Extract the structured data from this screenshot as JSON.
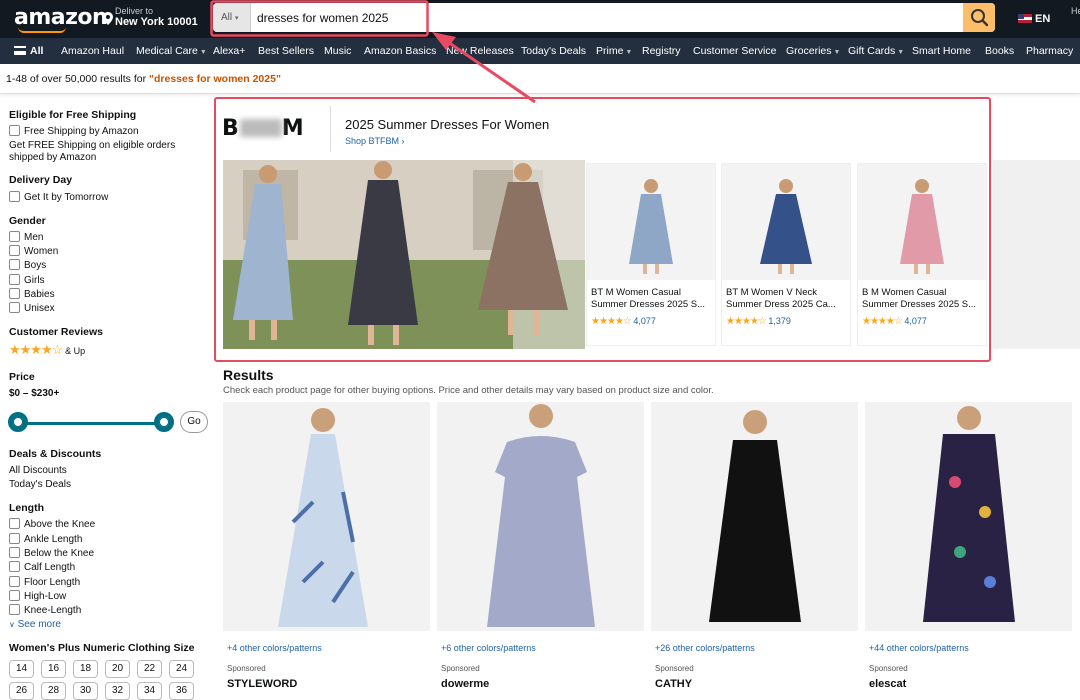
{
  "header": {
    "logo_text": "amazon",
    "deliver_line1": "Deliver to",
    "deliver_line2": "New York 10001",
    "search_category": "All",
    "search_query": "dresses for women 2025",
    "language": "EN",
    "account_partial": "He"
  },
  "nav": {
    "all_label": "All",
    "items": [
      "Amazon Haul",
      "Medical Care",
      "Alexa+",
      "Best Sellers",
      "Music",
      "Amazon Basics",
      "New Releases",
      "Today's Deals",
      "Prime",
      "Registry",
      "Customer Service",
      "Groceries",
      "Gift Cards",
      "Smart Home",
      "Books",
      "Pharmacy"
    ]
  },
  "results_bar": {
    "prefix": "1-48 of over 50,000 results for ",
    "query": "\"dresses for women 2025\""
  },
  "sidebar": {
    "shipping_heading": "Eligible for Free Shipping",
    "shipping_option": "Free Shipping by Amazon",
    "shipping_note_1": "Get FREE Shipping on eligible orders",
    "shipping_note_2": "shipped by Amazon",
    "delivery_heading": "Delivery Day",
    "delivery_option": "Get It by Tomorrow",
    "gender_heading": "Gender",
    "gender_options": [
      "Men",
      "Women",
      "Boys",
      "Girls",
      "Babies",
      "Unisex"
    ],
    "reviews_heading": "Customer Reviews",
    "reviews_suffix": "& Up",
    "price_heading": "Price",
    "price_range": "$0 – $230+",
    "price_go": "Go",
    "deals_heading": "Deals & Discounts",
    "deals_options": [
      "All Discounts",
      "Today's Deals"
    ],
    "length_heading": "Length",
    "length_options": [
      "Above the Knee",
      "Ankle Length",
      "Below the Knee",
      "Calf Length",
      "Floor Length",
      "High-Low",
      "Knee-Length"
    ],
    "see_more": "See more",
    "size_heading": "Women's Plus Numeric Clothing Size",
    "sizes": [
      "14",
      "16",
      "18",
      "20",
      "22",
      "24",
      "26",
      "28",
      "30",
      "32",
      "34",
      "36"
    ]
  },
  "banner": {
    "brand_left": "B",
    "brand_right": "M",
    "title": "2025 Summer Dresses For Women",
    "shop_link": "Shop BTFBM",
    "products": [
      {
        "title": "BT M Women Casual Summer Dresses 2025 S...",
        "rating_count": "4,077",
        "stars": 4.5
      },
      {
        "title": "BT M Women V Neck Summer Dress 2025 Ca...",
        "rating_count": "1,379",
        "stars": 4.5
      },
      {
        "title": "B M Women Casual Summer Dresses 2025 S...",
        "rating_count": "4,077",
        "stars": 4.5
      }
    ]
  },
  "results": {
    "title": "Results",
    "subtitle": "Check each product page for other buying options. Price and other details may vary based on product size and color.",
    "products": [
      {
        "colors": "+4 other colors/patterns",
        "sponsored": "Sponsored",
        "brand": "STYLEWORD"
      },
      {
        "colors": "+6 other colors/patterns",
        "sponsored": "Sponsored",
        "brand": "dowerme"
      },
      {
        "colors": "+26 other colors/patterns",
        "sponsored": "Sponsored",
        "brand": "CATHY"
      },
      {
        "colors": "+44 other colors/patterns",
        "sponsored": "Sponsored",
        "brand": "elescat"
      }
    ]
  },
  "colors": {
    "header_bg": "#131921",
    "nav_bg": "#232f3e",
    "search_button": "#febd69",
    "accent_orange": "#ff9900",
    "link_blue": "#2162a1",
    "highlight_red": "#e84a61",
    "slider_teal": "#007185"
  }
}
